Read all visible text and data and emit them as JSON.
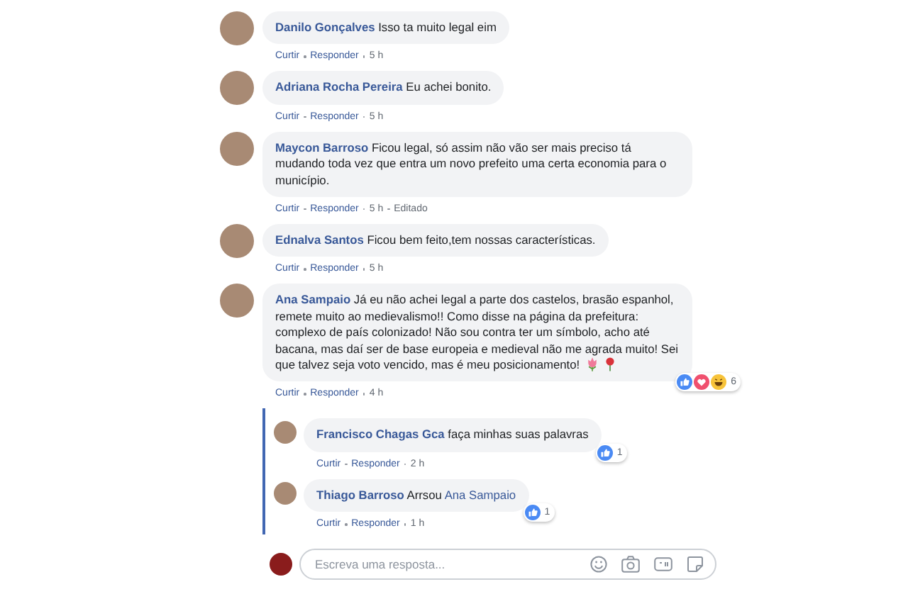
{
  "comments": [
    {
      "author": "Danilo Gonçalves",
      "text": "Isso ta muito legal eim",
      "actions": [
        "Curtir",
        "Responder",
        "5 h"
      ]
    },
    {
      "author": "Adriana Rocha Pereira",
      "text": "Eu achei bonito.",
      "actions": [
        "Curtir",
        "Responder",
        "5 h"
      ]
    },
    {
      "author": "Maycon Barroso",
      "text": "Ficou legal, só assim não vão ser mais preciso tá mudando toda vez que entra um novo prefeito uma certa economia para o município.",
      "actions": [
        "Curtir",
        "Responder",
        "5 h",
        "Editado"
      ]
    },
    {
      "author": "Ednalva Santos",
      "text": "Ficou bem feito,tem nossas características.",
      "actions": [
        "Curtir",
        "Responder",
        "5 h"
      ]
    },
    {
      "author": "Ana Sampaio",
      "text": "Já eu não achei legal a parte dos castelos, brasão espanhol, remete muito ao medievalismo!! Como disse na página da prefeitura: complexo de país colonizado! Não sou contra ter um símbolo, acho até bacana, mas daí ser de base europeia e medieval não me agrada muito! Sei que talvez seja voto vencido, mas é meu posicionamento!",
      "flowers": true,
      "actions": [
        "Curtir",
        "Responder",
        "4 h"
      ],
      "reactions": [
        {
          "kind": "like"
        },
        {
          "kind": "love"
        },
        {
          "kind": "haha"
        }
      ],
      "reaction_count": "6",
      "replies": [
        {
          "author": "Francisco Chagas Gca",
          "text": "faça minhas suas palavras",
          "actions": [
            "Curtir",
            "Responder",
            "2 h"
          ],
          "reactions": [
            {
              "kind": "like"
            }
          ],
          "reaction_count": "1"
        },
        {
          "author": "Thiago Barroso",
          "text": "Arrsou",
          "mention": "Ana Sampaio",
          "actions": [
            "Curtir",
            "Responder",
            "1 h"
          ],
          "reactions": [
            {
              "kind": "like"
            }
          ],
          "reaction_count": "1"
        }
      ]
    }
  ],
  "reply_box": {
    "placeholder": "Escreva uma resposta..."
  }
}
